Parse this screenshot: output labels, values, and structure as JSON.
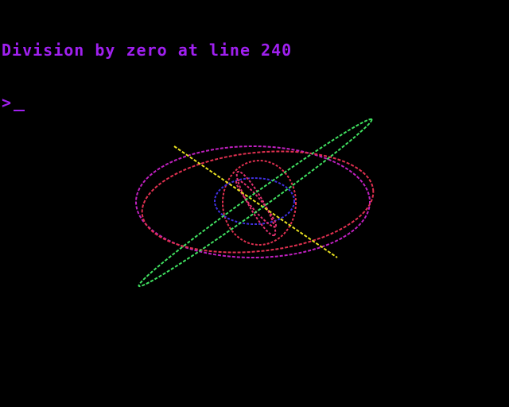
{
  "terminal": {
    "error_message": "Division by zero at line 240",
    "prompt": ">",
    "text_color": "#a020f0"
  },
  "graphics": {
    "background": "#000000",
    "colors": {
      "magenta": "#c020c0",
      "red": "#e03050",
      "blue": "#4030e0",
      "green": "#40e060",
      "yellow": "#e8e020",
      "pink": "#e03070"
    }
  }
}
